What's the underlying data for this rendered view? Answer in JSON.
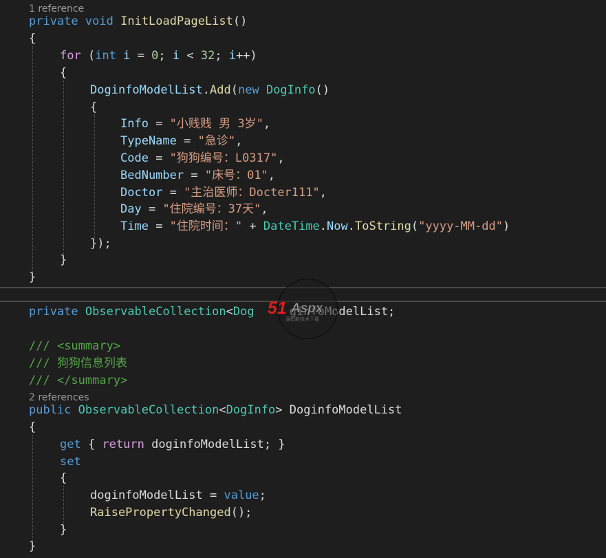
{
  "code": {
    "codelens_1": "1 reference",
    "method_signature": {
      "kw_private": "private",
      "kw_void": "void",
      "method_name": "InitLoadPageList",
      "parens": "()"
    },
    "brace_open_1": "{",
    "for_line": {
      "kw_for": "for",
      "p1": " (",
      "kw_int": "int",
      "sp": " ",
      "var_i1": "i",
      "eq": " = ",
      "zero": "0",
      "semi1": "; ",
      "var_i2": "i",
      "lt": " < ",
      "n32": "32",
      "semi2": "; ",
      "var_i3": "i",
      "inc": "++)"
    },
    "brace_open_2": "{",
    "add_line": {
      "list_name": "DoginfoModelList",
      "dot": ".",
      "add": "Add",
      "p": "(",
      "kw_new": "new",
      "sp": " ",
      "type_doginfo": "DogInfo",
      "parens": "()"
    },
    "brace_open_3": "{",
    "properties": [
      {
        "name": "Info",
        "eq": " = ",
        "value": "\"小贱贱 男 3岁\"",
        "tail": ","
      },
      {
        "name": "TypeName",
        "eq": " = ",
        "value": "\"急诊\"",
        "tail": ","
      },
      {
        "name": "Code",
        "eq": " = ",
        "value": "\"狗狗编号：L0317\"",
        "tail": ","
      },
      {
        "name": "BedNumber",
        "eq": " = ",
        "value": "\"床号：01\"",
        "tail": ","
      },
      {
        "name": "Doctor",
        "eq": " = ",
        "value": "\"主治医师：Docter111\"",
        "tail": ","
      },
      {
        "name": "Day",
        "eq": " = ",
        "value": "\"住院编号：37天\"",
        "tail": ","
      }
    ],
    "time_line": {
      "name": "Time",
      "eq": " = ",
      "str": "\"住院时间：\"",
      "plus": " + ",
      "datetime": "DateTime",
      "dot1": ".",
      "now": "Now",
      "dot2": ".",
      "tostring": "ToString",
      "p1": "(",
      "fmt": "\"yyyy-MM-dd\"",
      "p2": ")"
    },
    "close_object": "});",
    "brace_close_2": "}",
    "brace_close_1": "}",
    "field_decl": {
      "kw_private": "private",
      "sp1": " ",
      "type_oc": "ObservableCollection",
      "lt": "<",
      "type_dog_partial": "Dog",
      "hidden_gap": "     ",
      "name_tail": "ginfoModelList;"
    },
    "doc_comments": [
      {
        "slashes": "/// ",
        "text": "<summary>"
      },
      {
        "slashes": "/// ",
        "text": "狗狗信息列表"
      },
      {
        "slashes": "/// ",
        "text": "</summary>"
      }
    ],
    "codelens_2": "2 references",
    "prop_decl": {
      "kw_public": "public",
      "sp1": " ",
      "type_oc": "ObservableCollection",
      "lt": "<",
      "type_doginfo": "DogInfo",
      "gt": ">",
      "name": " DoginfoModelList"
    },
    "brace_open_p": "{",
    "get_line": {
      "kw_get": "get",
      "b1": " { ",
      "kw_return": "return",
      "rest": " doginfoModelList; }"
    },
    "set_line": {
      "kw_set": "set"
    },
    "brace_open_set": "{",
    "assign_line": {
      "field": "doginfoModelList",
      "eq": " = ",
      "kw_value": "value",
      "semi": ";"
    },
    "raise_line": {
      "method": "RaisePropertyChanged",
      "rest": "();"
    },
    "brace_close_set": "}",
    "brace_close_p": "}"
  },
  "watermark": {
    "logo_red": "51",
    "logo_gray": "Aspx",
    "tagline": "源码新技术下载"
  },
  "colors": {
    "background": "#1e1e1e",
    "keyword": "#569cd6",
    "control_keyword": "#d8a0df",
    "type": "#4ec9b0",
    "method": "#dcdcaa",
    "variable": "#9cdcfe",
    "number": "#b5cea8",
    "string": "#d69d85",
    "doc_comment": "#57a64a"
  }
}
